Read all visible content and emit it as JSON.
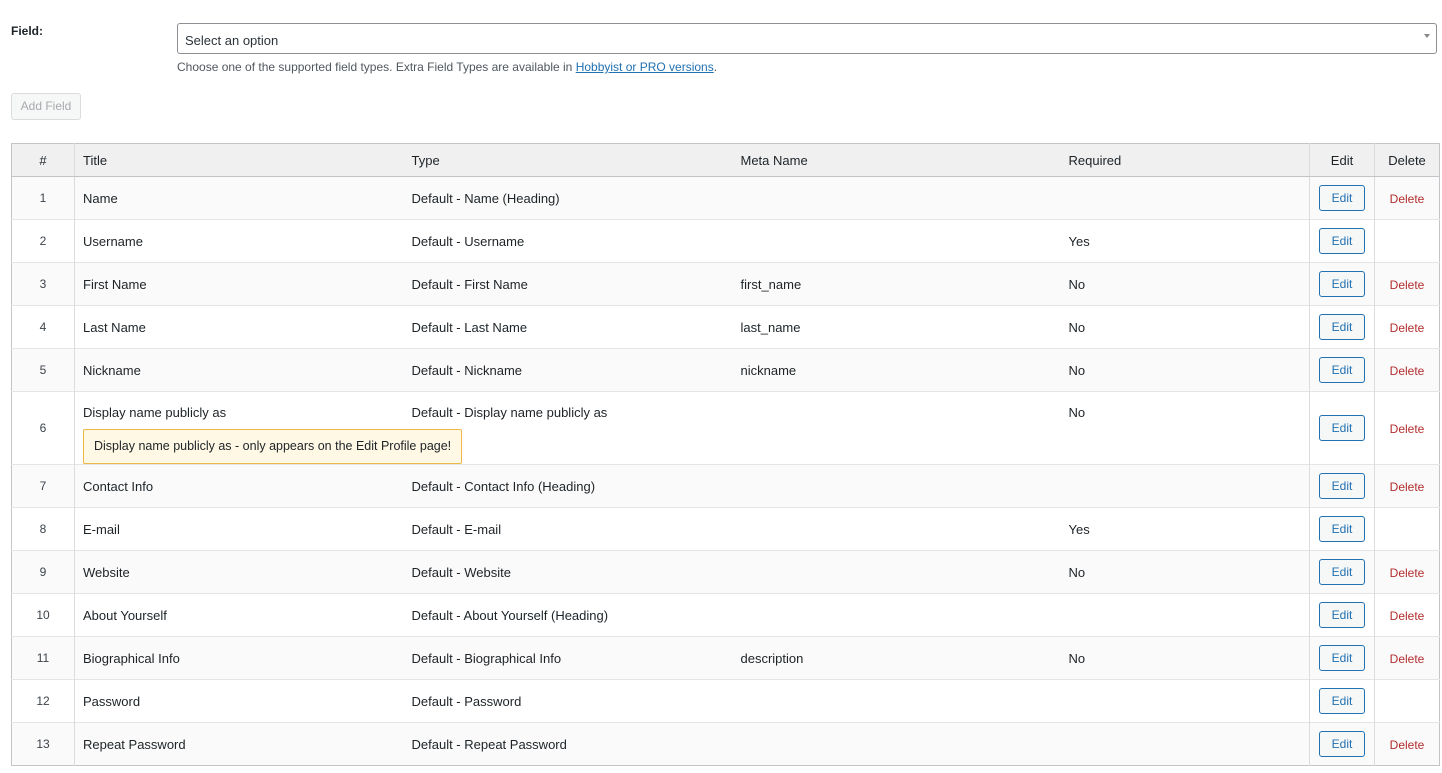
{
  "form": {
    "field_label": "Field:",
    "select_value": "Select an option",
    "help_text": "Choose one of the supported field types. Extra Field Types are available in ",
    "help_link": "Hobbyist or PRO versions",
    "help_end": ".",
    "add_button": "Add Field"
  },
  "table": {
    "headers": {
      "num": "#",
      "title": "Title",
      "type": "Type",
      "meta": "Meta Name",
      "required": "Required",
      "edit": "Edit",
      "delete": "Delete"
    },
    "edit_label": "Edit",
    "delete_label": "Delete",
    "rows": [
      {
        "num": "1",
        "title": "Name",
        "type": "Default - Name (Heading)",
        "meta": "",
        "required": "",
        "delete": "Delete"
      },
      {
        "num": "2",
        "title": "Username",
        "type": "Default - Username",
        "meta": "",
        "required": "Yes",
        "delete": ""
      },
      {
        "num": "3",
        "title": "First Name",
        "type": "Default - First Name",
        "meta": "first_name",
        "required": "No",
        "delete": "Delete"
      },
      {
        "num": "4",
        "title": "Last Name",
        "type": "Default - Last Name",
        "meta": "last_name",
        "required": "No",
        "delete": "Delete"
      },
      {
        "num": "5",
        "title": "Nickname",
        "type": "Default - Nickname",
        "meta": "nickname",
        "required": "No",
        "delete": "Delete"
      },
      {
        "num": "6",
        "title": "Display name publicly as",
        "type": "Default - Display name publicly as",
        "meta": "",
        "required": "No",
        "delete": "Delete",
        "notice": "Display name publicly as - only appears on the Edit Profile page!"
      },
      {
        "num": "7",
        "title": "Contact Info",
        "type": "Default - Contact Info (Heading)",
        "meta": "",
        "required": "",
        "delete": "Delete"
      },
      {
        "num": "8",
        "title": "E-mail",
        "type": "Default - E-mail",
        "meta": "",
        "required": "Yes",
        "delete": ""
      },
      {
        "num": "9",
        "title": "Website",
        "type": "Default - Website",
        "meta": "",
        "required": "No",
        "delete": "Delete"
      },
      {
        "num": "10",
        "title": "About Yourself",
        "type": "Default - About Yourself (Heading)",
        "meta": "",
        "required": "",
        "delete": "Delete"
      },
      {
        "num": "11",
        "title": "Biographical Info",
        "type": "Default - Biographical Info",
        "meta": "description",
        "required": "No",
        "delete": "Delete"
      },
      {
        "num": "12",
        "title": "Password",
        "type": "Default - Password",
        "meta": "",
        "required": "",
        "delete": ""
      },
      {
        "num": "13",
        "title": "Repeat Password",
        "type": "Default - Repeat Password",
        "meta": "",
        "required": "",
        "delete": "Delete"
      }
    ]
  },
  "colors": {
    "link": "#2271b1",
    "delete": "#b32d2e",
    "notice_border": "#f0b849",
    "notice_bg": "#fff8e5"
  }
}
